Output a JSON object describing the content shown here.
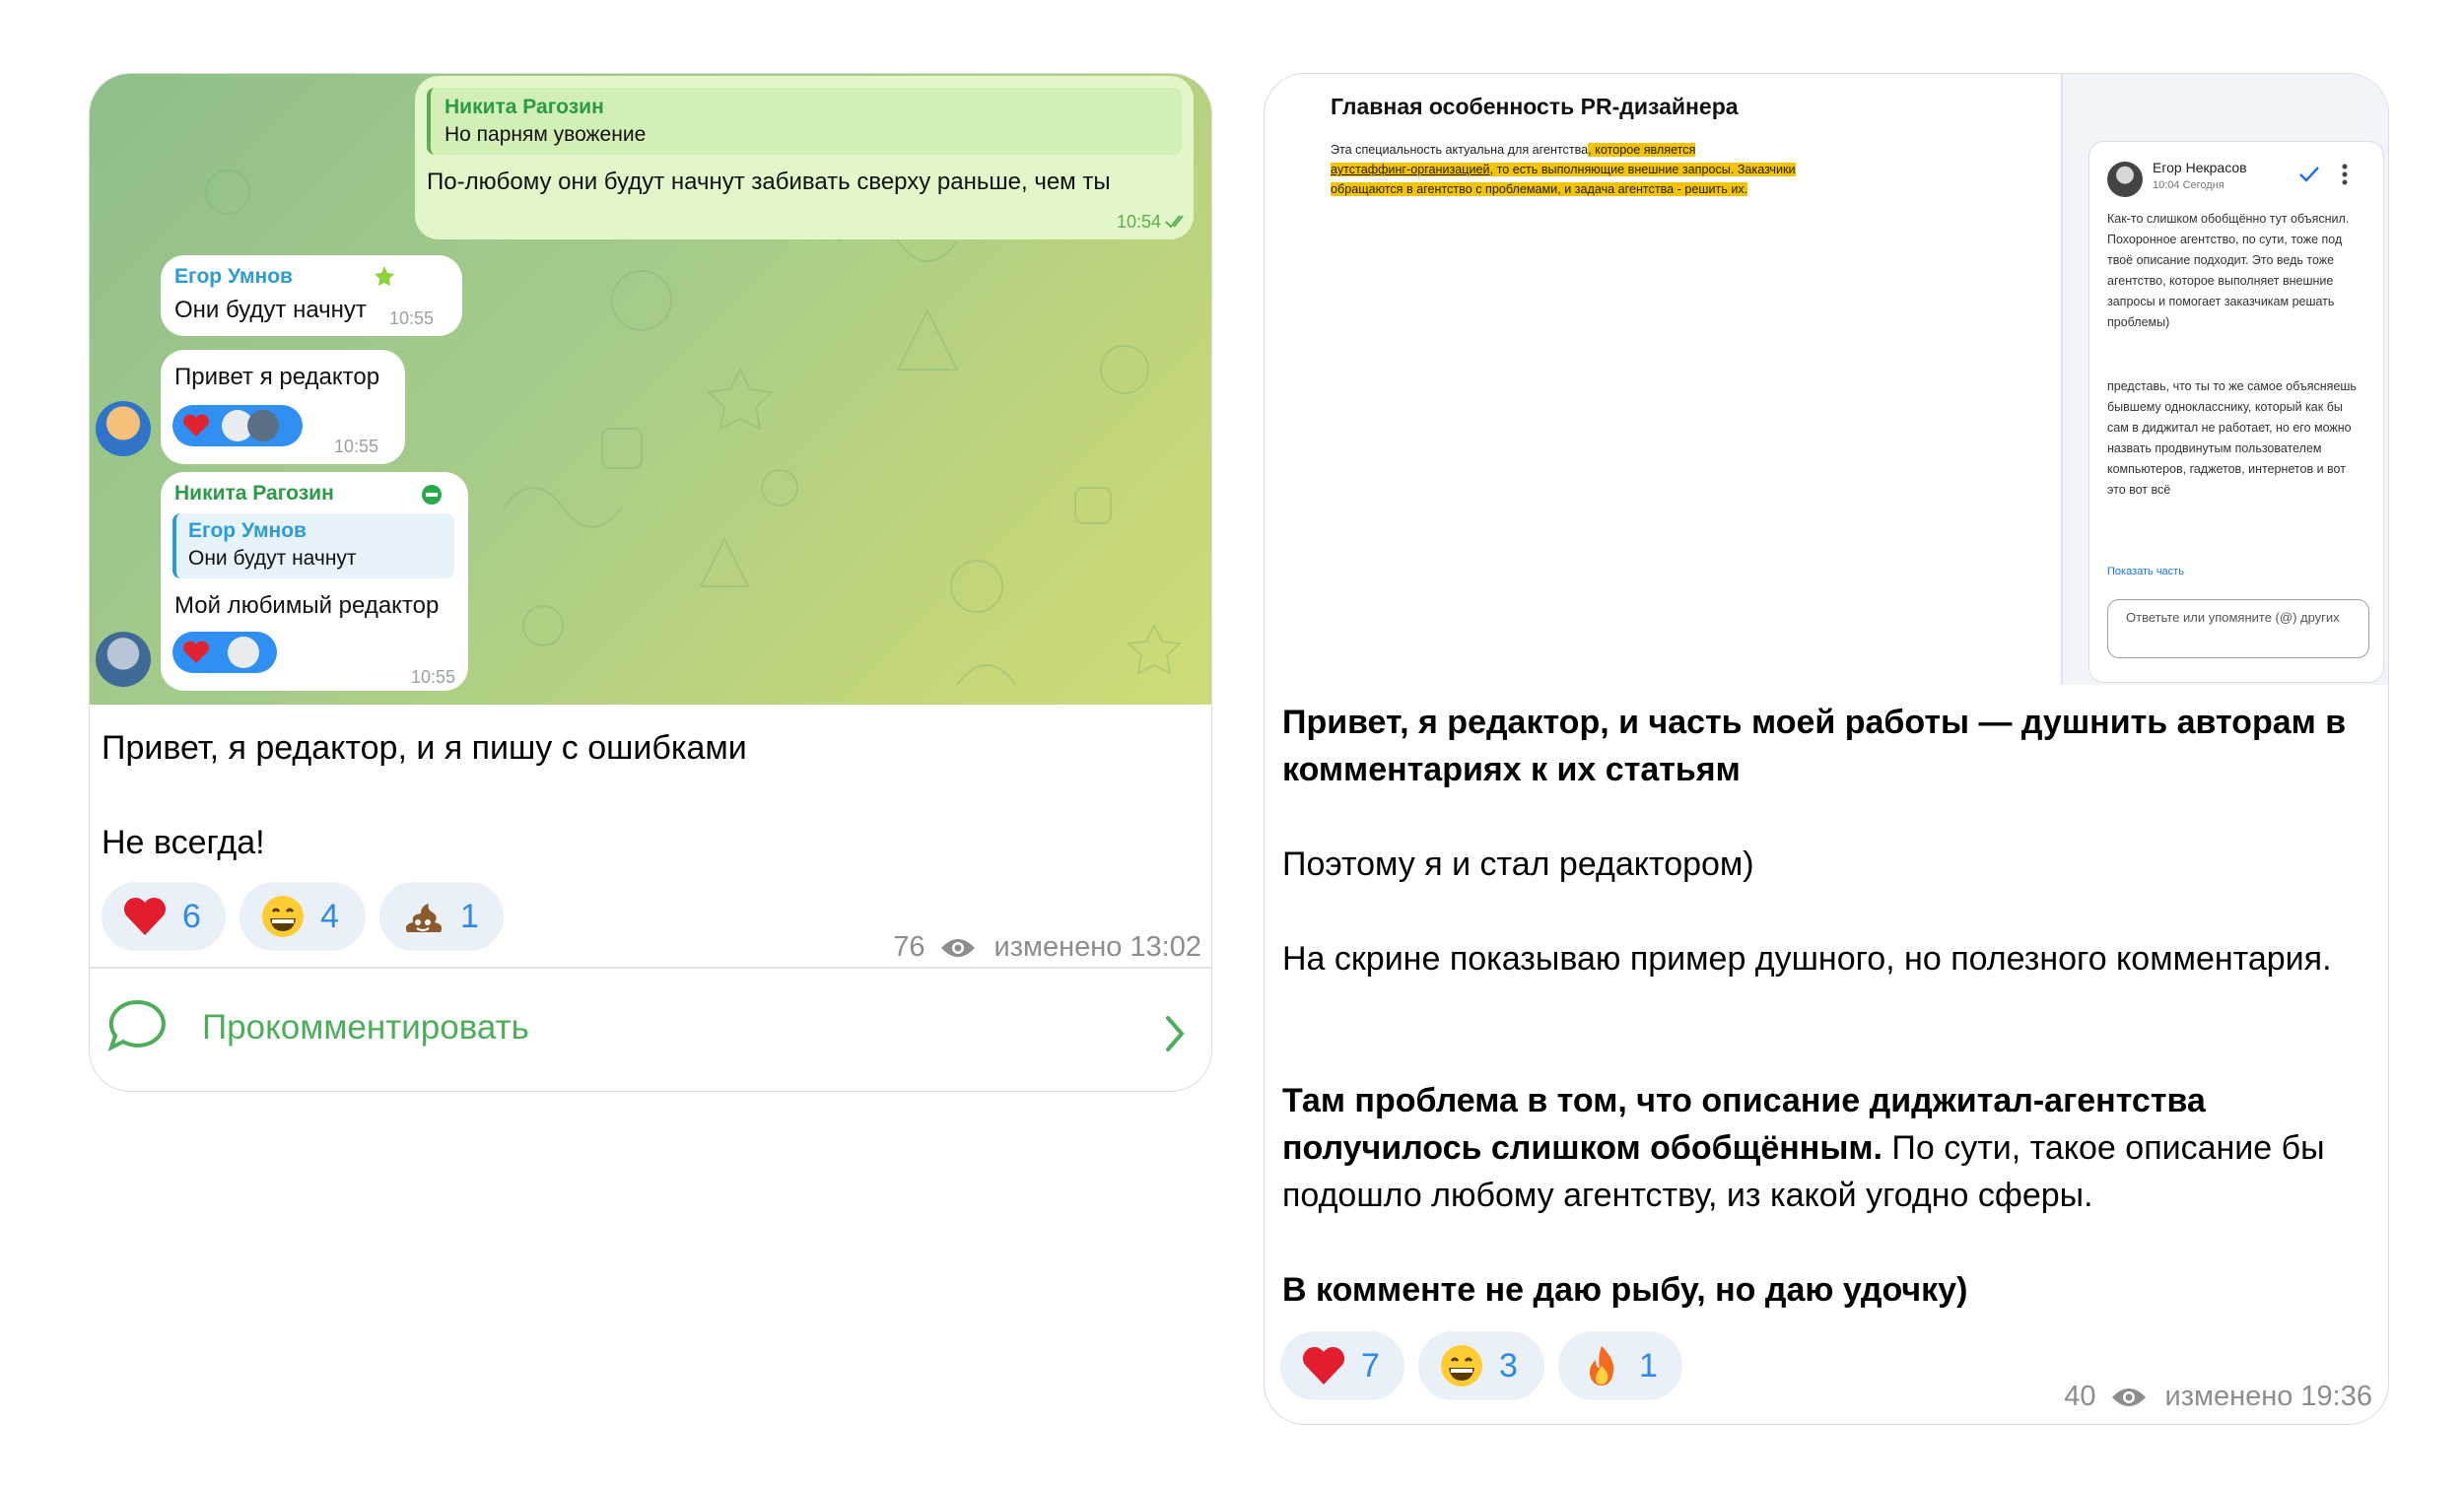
{
  "post1": {
    "chat": {
      "msg1": {
        "reply_name": "Никита Рагозин",
        "reply_text": "Но парням увожение",
        "text": "По-любому они будут начнут забивать сверху раньше, чем ты",
        "time": "10:54"
      },
      "msg2": {
        "name": "Егор Умнов",
        "text": "Они будут начнут",
        "time": "10:55"
      },
      "msg3": {
        "text": "Привет я редактор",
        "time": "10:55"
      },
      "msg4": {
        "name": "Никита Рагозин",
        "reply_name": "Егор Умнов",
        "reply_text": "Они будут начнут",
        "text": "Мой любимый редактор",
        "time": "10:55"
      }
    },
    "text_line1": "Привет, я редактор, и я пишу с ошибками",
    "text_line2": "Не всегда!",
    "reactions": [
      {
        "icon": "heart",
        "count": "6"
      },
      {
        "icon": "grinning-face",
        "count": "4"
      },
      {
        "icon": "pile-of-poo",
        "count": "1"
      }
    ],
    "views": "76",
    "edited": "изменено 13:02",
    "comment_label": "Прокомментировать"
  },
  "post2": {
    "doc": {
      "title": "Главная особенность PR-дизайнера",
      "line1_plain": "Эта специальность актуальна для агентства",
      "line1_hl": ", которое является",
      "line2_hl": "аутстаффинг-организацией",
      "line2_plain": ", то есть выполняющие внешние запросы. Заказчики",
      "line3": "обращаются в агентство с проблемами, и задача агентства - решить их.",
      "commenter": "Егор Некрасов",
      "comment_time": "10:04 Сегодня",
      "comment_para1": "Как-то слишком обобщённо тут объяснил. Похоронное агентство, по сути, тоже под твоё описание подходит. Это ведь тоже агентство, которое выполняет внешние запросы и помогает заказчикам решать проблемы)",
      "comment_para2": "представь, что ты то же самое объясняешь бывшему однокласснику, который как бы сам в диджитал не работает, но его можно назвать продвинутым пользователем компьютеров, гаджетов, интернетов и вот это вот всё",
      "show_more": "Показать часть",
      "reply_placeholder": "Ответьте или упомяните (@) других"
    },
    "p1": "Привет, я редактор, и часть моей работы — душнить авторам в комментариях к их статьям",
    "p2": "Поэтому я и стал редактором)",
    "p3": "На скрине показываю пример душного, но полезного комментария.",
    "p4_bold": "Там проблема в том, что описание диджитал-агентства получилось слишком обобщённым.",
    "p4_rest": " По сути, такое описание бы подошло любому агентству, из какой угодно сферы.",
    "p5": "В комменте не даю рыбу, но даю удочку)",
    "reactions": [
      {
        "icon": "heart",
        "count": "7"
      },
      {
        "icon": "grinning-face",
        "count": "3"
      },
      {
        "icon": "fire",
        "count": "1"
      }
    ],
    "views": "40",
    "edited": "изменено 19:36"
  },
  "colors": {
    "accent_blue": "#2e8ae6",
    "comment_green": "#4cae59",
    "highlight": "#f5c400"
  }
}
